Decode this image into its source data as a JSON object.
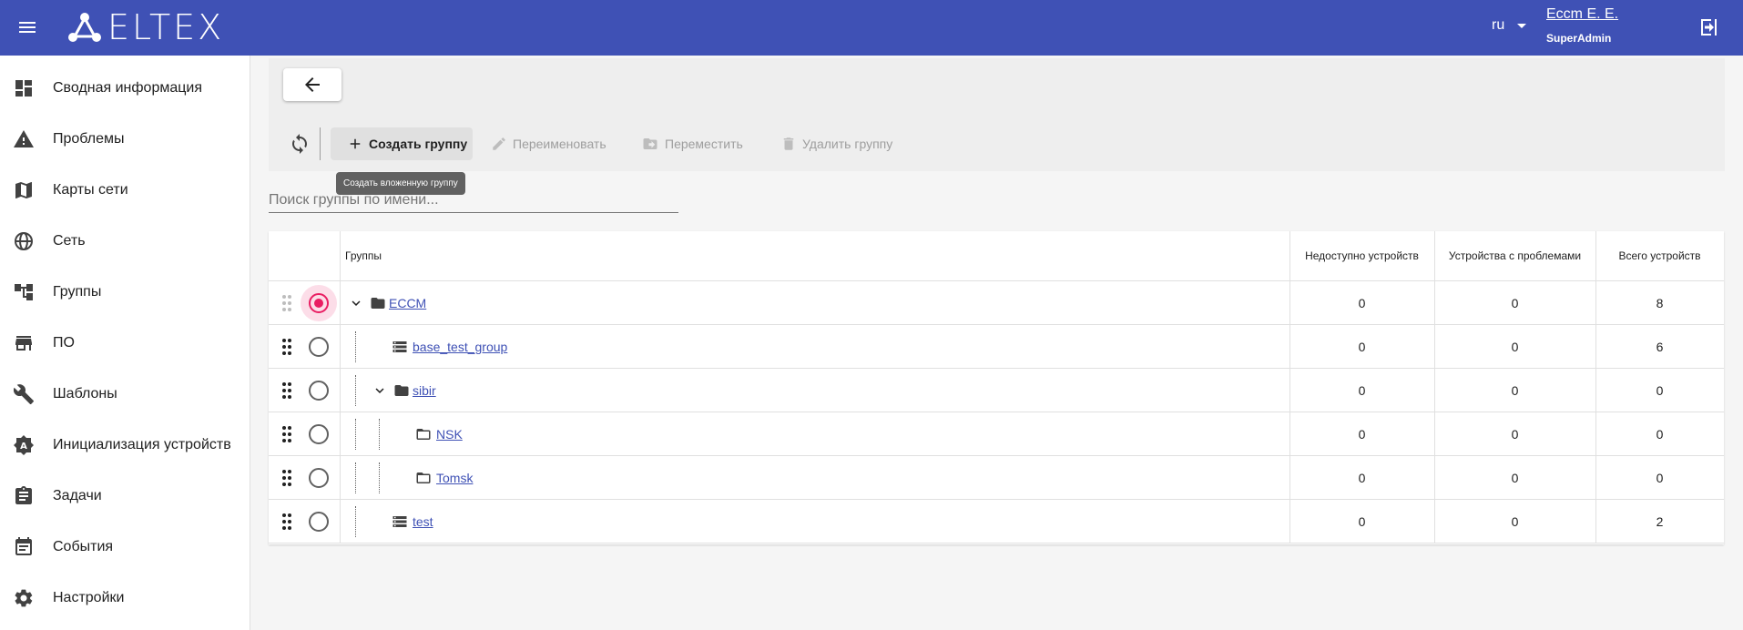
{
  "header": {
    "logo_text": "ELTEX",
    "language": "ru",
    "user_name": "Eccm E. E.",
    "user_role": "SuperAdmin"
  },
  "sidebar": {
    "items": [
      {
        "label": "Сводная информация",
        "icon": "dashboard-icon"
      },
      {
        "label": "Проблемы",
        "icon": "warning-icon"
      },
      {
        "label": "Карты сети",
        "icon": "map-icon"
      },
      {
        "label": "Сеть",
        "icon": "globe-icon"
      },
      {
        "label": "Группы",
        "icon": "tree-icon"
      },
      {
        "label": "ПО",
        "icon": "store-icon"
      },
      {
        "label": "Шаблоны",
        "icon": "wrench-icon"
      },
      {
        "label": "Инициализация устройств",
        "icon": "auto-icon"
      },
      {
        "label": "Задачи",
        "icon": "clipboard-icon"
      },
      {
        "label": "События",
        "icon": "calendar-icon"
      },
      {
        "label": "Настройки",
        "icon": "gear-icon"
      }
    ]
  },
  "toolbar": {
    "create_label": "Создать группу",
    "rename_label": "Переименовать",
    "move_label": "Переместить",
    "delete_label": "Удалить группу",
    "tooltip": "Создать вложенную группу"
  },
  "search": {
    "placeholder": "Поиск группы по имени..."
  },
  "table": {
    "headers": {
      "groups": "Группы",
      "unavailable": "Недоступно устройств",
      "problems": "Устройства с проблемами",
      "total": "Всего устройств"
    },
    "rows": [
      {
        "name": "ECCM",
        "unavailable": "0",
        "problems": "0",
        "total": "8"
      },
      {
        "name": "base_test_group",
        "unavailable": "0",
        "problems": "0",
        "total": "6"
      },
      {
        "name": "sibir",
        "unavailable": "0",
        "problems": "0",
        "total": "0"
      },
      {
        "name": "NSK",
        "unavailable": "0",
        "problems": "0",
        "total": "0"
      },
      {
        "name": "Tomsk",
        "unavailable": "0",
        "problems": "0",
        "total": "0"
      },
      {
        "name": "test",
        "unavailable": "0",
        "problems": "0",
        "total": "2"
      }
    ]
  },
  "colors": {
    "header_bg": "#3f51b5",
    "accent": "#e91e63",
    "link": "#3f51b5"
  }
}
